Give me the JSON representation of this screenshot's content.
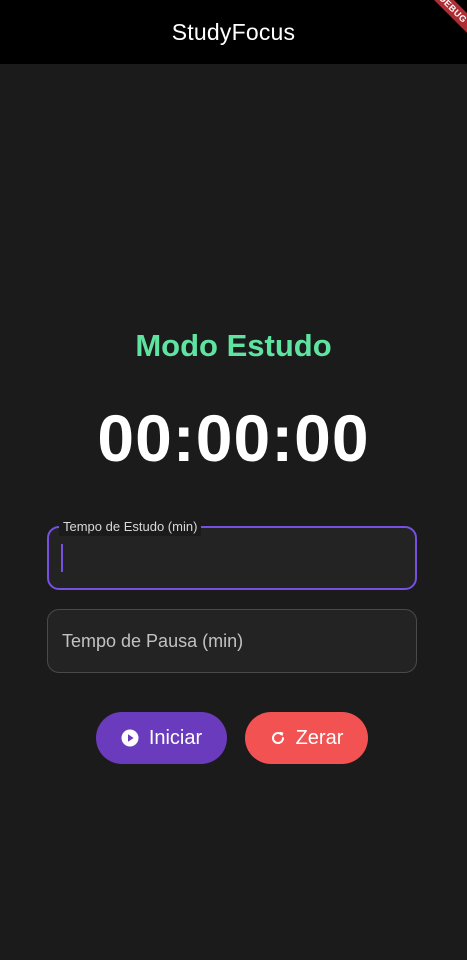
{
  "appbar": {
    "title": "StudyFocus",
    "debug_banner": "DEBUG"
  },
  "main": {
    "mode_title": "Modo Estudo",
    "timer": "00:00:00"
  },
  "fields": {
    "study": {
      "label": "Tempo de Estudo (min)",
      "value": ""
    },
    "pause": {
      "placeholder": "Tempo de Pausa (min)",
      "value": ""
    }
  },
  "buttons": {
    "start": {
      "label": "Iniciar",
      "icon": "play-circle-icon"
    },
    "reset": {
      "label": "Zerar",
      "icon": "refresh-icon"
    }
  },
  "colors": {
    "accent": "#7650e0",
    "mode_title": "#5fe3a1",
    "start_button": "#6b3bbd",
    "reset_button": "#f25252",
    "background": "#1b1b1b",
    "appbar": "#000000"
  }
}
